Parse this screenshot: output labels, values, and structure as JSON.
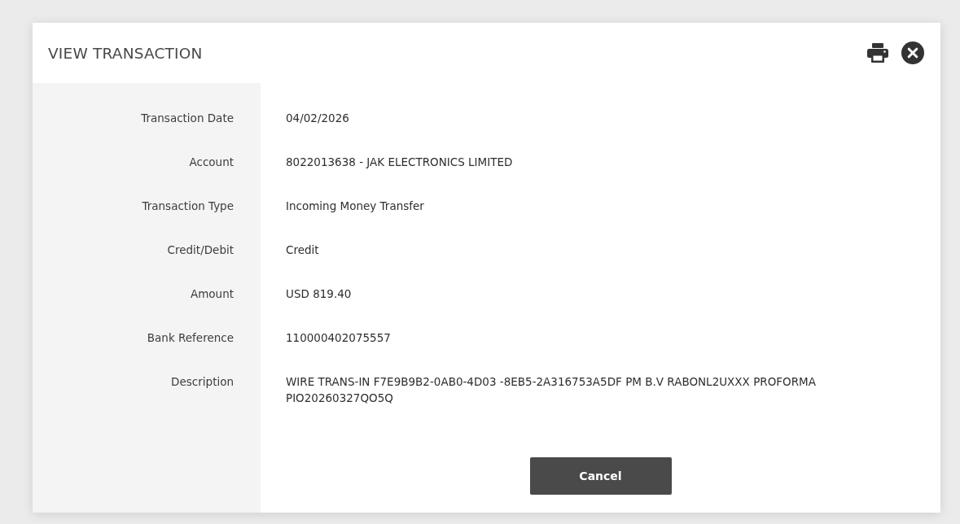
{
  "dialog": {
    "title": "VIEW TRANSACTION"
  },
  "fields": [
    {
      "label": "Transaction Date",
      "value": "04/02/2026"
    },
    {
      "label": "Account",
      "value": "8022013638 - JAK ELECTRONICS LIMITED"
    },
    {
      "label": "Transaction Type",
      "value": "Incoming Money Transfer"
    },
    {
      "label": "Credit/Debit",
      "value": "Credit"
    },
    {
      "label": "Amount",
      "value": "USD 819.40"
    },
    {
      "label": "Bank Reference",
      "value": "110000402075557"
    },
    {
      "label": "Description",
      "value": "WIRE TRANS-IN F7E9B9B2-0AB0-4D03 -8EB5-2A316753A5DF PM B.V RABONL2UXXX PROFORMA PIO20260327QO5Q"
    }
  ],
  "buttons": [
    "Cancel"
  ]
}
